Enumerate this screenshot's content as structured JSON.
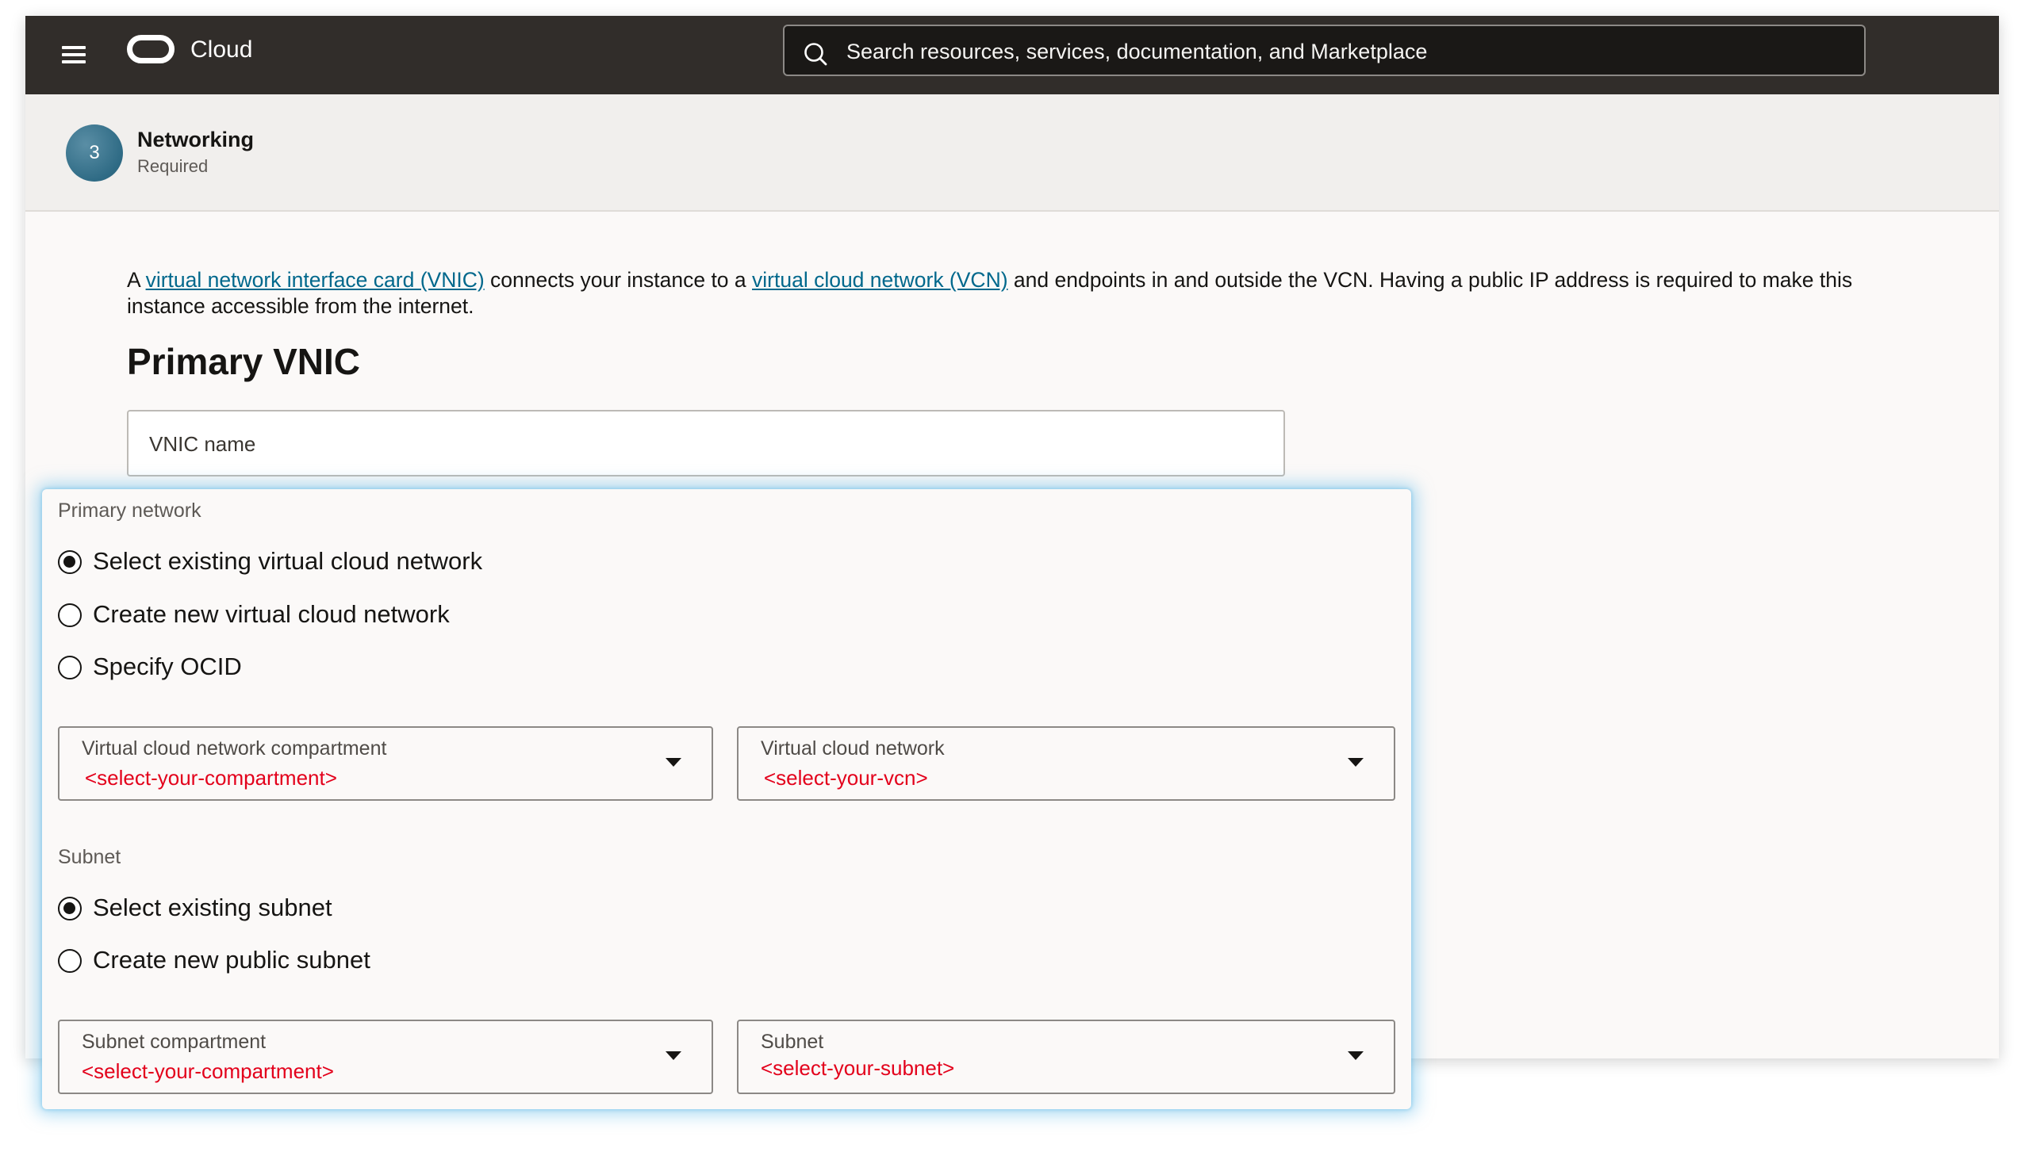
{
  "header": {
    "brand": "Cloud",
    "search_placeholder": "Search resources, services, documentation, and Marketplace"
  },
  "step": {
    "number": "3",
    "title": "Networking",
    "subtitle": "Required"
  },
  "description": {
    "part1": "A ",
    "link1": "virtual network interface card (VNIC)",
    "part2": " connects your instance to a ",
    "link2": "virtual cloud network (VCN)",
    "part3": " and endpoints in and outside the VCN. Having a public IP address is required to make this instance accessible from the internet."
  },
  "primary_vnic": {
    "heading": "Primary VNIC",
    "vnic_name_label": "VNIC name"
  },
  "primary_network": {
    "label": "Primary network",
    "options": [
      {
        "label": "Select existing virtual cloud network",
        "selected": true
      },
      {
        "label": "Create new virtual cloud network",
        "selected": false
      },
      {
        "label": "Specify OCID",
        "selected": false
      }
    ],
    "compartment_select": {
      "label": "Virtual cloud network compartment",
      "value": "<select-your-compartment>"
    },
    "vcn_select": {
      "label": "Virtual cloud network",
      "value": "<select-your-vcn>"
    }
  },
  "subnet": {
    "label": "Subnet",
    "options": [
      {
        "label": "Select existing subnet",
        "selected": true
      },
      {
        "label": "Create new public subnet",
        "selected": false
      }
    ],
    "compartment_select": {
      "label": "Subnet compartment",
      "value": "<select-your-compartment>"
    },
    "subnet_select": {
      "label": "Subnet",
      "value": "<select-your-subnet>"
    }
  },
  "colors": {
    "header_bg": "#312d2a",
    "link": "#00688c",
    "placeholder_red": "#e3001b",
    "highlight_glow": "#60bae8"
  }
}
